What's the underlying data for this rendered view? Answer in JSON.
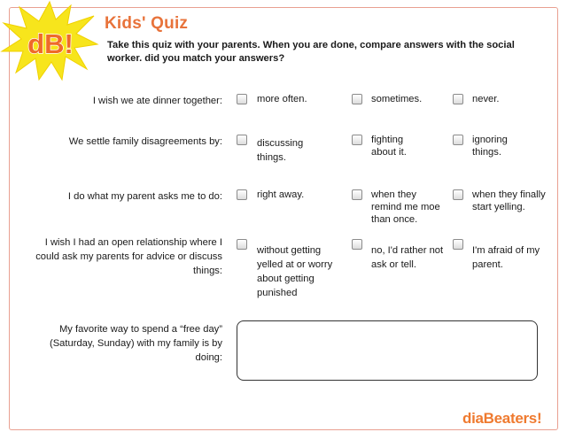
{
  "header": {
    "badge": "dB!",
    "title": "Kids' Quiz",
    "intro": "Take this quiz with your parents. When you are done, compare answers with the social worker.  did you match your answers?"
  },
  "questions": [
    {
      "label": "I wish we ate dinner together:",
      "options": [
        "more often.",
        "sometimes.",
        "never."
      ]
    },
    {
      "label": "We settle family disagreements by:",
      "options": [
        "discussing things.",
        "fighting about it.",
        "ignoring things."
      ]
    },
    {
      "label": "I do what my parent asks me to do:",
      "options": [
        "right away.",
        "when they remind me moe than once.",
        "when they finally start yelling."
      ]
    },
    {
      "label": "I wish I had an open relationship where I could ask my parents for advice or discuss things:",
      "options": [
        "without getting yelled at or worry about getting punished",
        "no, I'd rather not ask or tell.",
        "I'm afraid of my parent."
      ]
    }
  ],
  "free_day": {
    "label": "My favorite way to spend a “free day” (Saturday, Sunday) with my family is by doing:",
    "value": ""
  },
  "footer": {
    "logo_prefix": "dia",
    "logo_suffix": "Beaters!"
  },
  "colors": {
    "accent": "#e8733b",
    "frame": "#e9a091",
    "burst": "#f7e51c"
  }
}
